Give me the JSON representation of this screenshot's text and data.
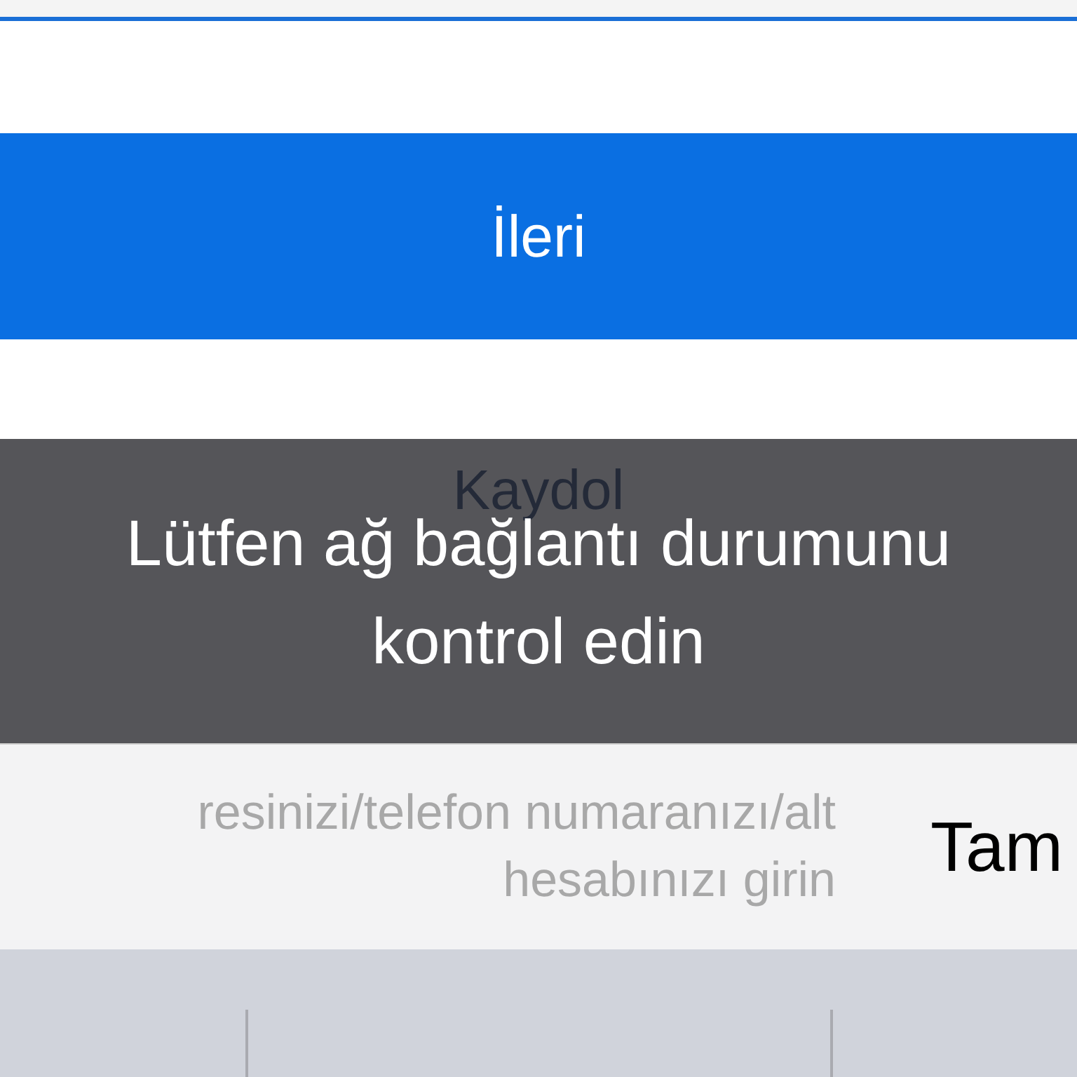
{
  "next_button": {
    "label": "İleri"
  },
  "register_link": {
    "label": "Kaydol"
  },
  "toast": {
    "message": "Lütfen ağ bağlantı durumunu kontrol edin"
  },
  "input_bar": {
    "placeholder": "resinizi/telefon numaranızı/alt hesabınızı girin",
    "done_button": "Tam"
  }
}
